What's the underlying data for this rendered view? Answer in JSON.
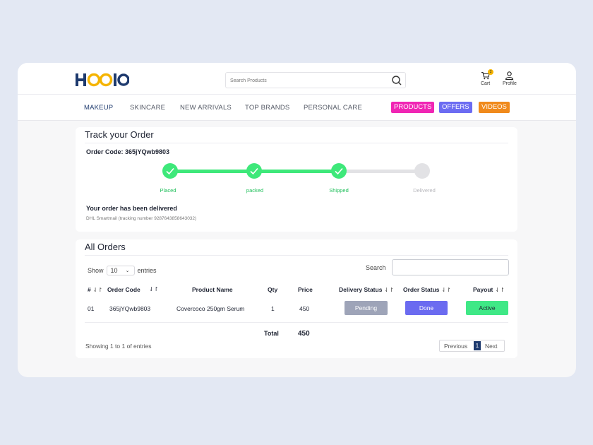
{
  "header": {
    "logo": "HOOIO",
    "search_placeholder": "Search Products",
    "cart_label": "Cart",
    "cart_count": "2",
    "profile_label": "Profile"
  },
  "nav": {
    "items": [
      "MAKEUP",
      "SKINCARE",
      "NEW ARRIVALS",
      "TOP BRANDS",
      "PERSONAL CARE"
    ],
    "pills": [
      {
        "label": "PRODUCTS",
        "color": "#f026b4"
      },
      {
        "label": "OFFERS",
        "color": "#6c6cf2"
      },
      {
        "label": "VIDEOS",
        "color": "#f08a1c"
      }
    ]
  },
  "track": {
    "title": "Track your Order",
    "order_code": "Order Code: 365jYQwb9803",
    "steps": [
      {
        "label": "Placed",
        "done": true
      },
      {
        "label": "packed",
        "done": true
      },
      {
        "label": "Shipped",
        "done": true
      },
      {
        "label": "Delivered",
        "done": false
      }
    ],
    "message": "Your order has been delivered",
    "tracking": "DHL Smartmail (tracking number 9287643858643032)",
    "colors": {
      "done": "#3ee87a",
      "pending": "#e2e2e5",
      "done_text": "#1fbf5a",
      "pending_text": "#b8b8bd"
    }
  },
  "orders": {
    "title": "All Orders",
    "show_label": "Show",
    "entries_value": "10",
    "entries_label": "entries",
    "search_label": "Search",
    "columns": {
      "num": "#",
      "code": "Order Code",
      "product": "Product Name",
      "qty": "Qty",
      "price": "Price",
      "delivery": "Delivery Status",
      "order_status": "Order Status",
      "payout": "Payout"
    },
    "sort_icon": "⇃↾",
    "row": {
      "num": "01",
      "code": "365jYQwb9803",
      "product": "Covercoco 250gm Serum",
      "qty": "1",
      "price": "450",
      "delivery": "Pending",
      "order_status": "Done",
      "payout": "Active"
    },
    "total_label": "Total",
    "total_value": "450",
    "showing": "Showing 1 to 1 of entries",
    "pager": {
      "prev": "Previous",
      "current": "1",
      "next": "Next"
    },
    "colors": {
      "pending": "#9ea4b8",
      "done": "#6b6bf0",
      "active": "#3fe886"
    }
  }
}
